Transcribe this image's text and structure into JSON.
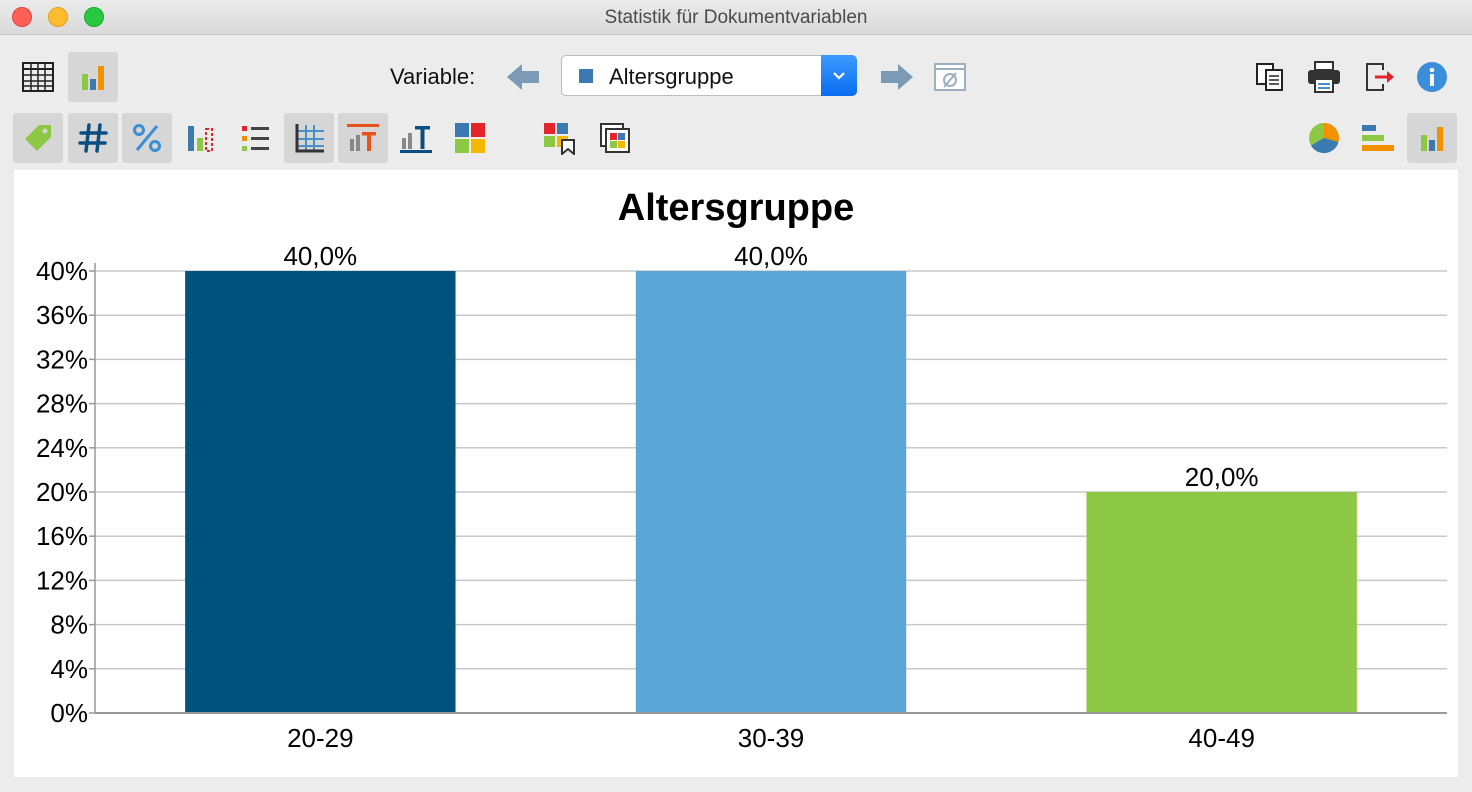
{
  "window": {
    "title": "Statistik für Dokumentvariablen"
  },
  "toolbar": {
    "variable_label": "Variable:",
    "selected_variable": "Altersgruppe"
  },
  "icons": {
    "table_view": "table-icon",
    "chart_view": "bar-chart-icon",
    "prev_var": "arrow-left-icon",
    "next_var": "arrow-right-icon",
    "missing": "empty-set-icon",
    "copy": "copy-icon",
    "print": "printer-icon",
    "export": "export-icon",
    "info": "info-icon"
  },
  "colors": {
    "bar_1": "#00527f",
    "bar_2": "#5aa6d6",
    "bar_3": "#8cc843",
    "accent_blue": "#1a7de8"
  },
  "chart_data": {
    "type": "bar",
    "title": "Altersgruppe",
    "categories": [
      "20-29",
      "30-39",
      "40-49"
    ],
    "values": [
      40,
      40,
      20
    ],
    "value_labels": [
      "40,0%",
      "40,0%",
      "20,0%"
    ],
    "colors": [
      "#00527f",
      "#5aa6d6",
      "#8cc843"
    ],
    "yticks": [
      "0%",
      "4%",
      "8%",
      "12%",
      "16%",
      "20%",
      "24%",
      "28%",
      "32%",
      "36%",
      "40%"
    ],
    "ylim": [
      0,
      40
    ],
    "grid": true,
    "legend": "none"
  }
}
